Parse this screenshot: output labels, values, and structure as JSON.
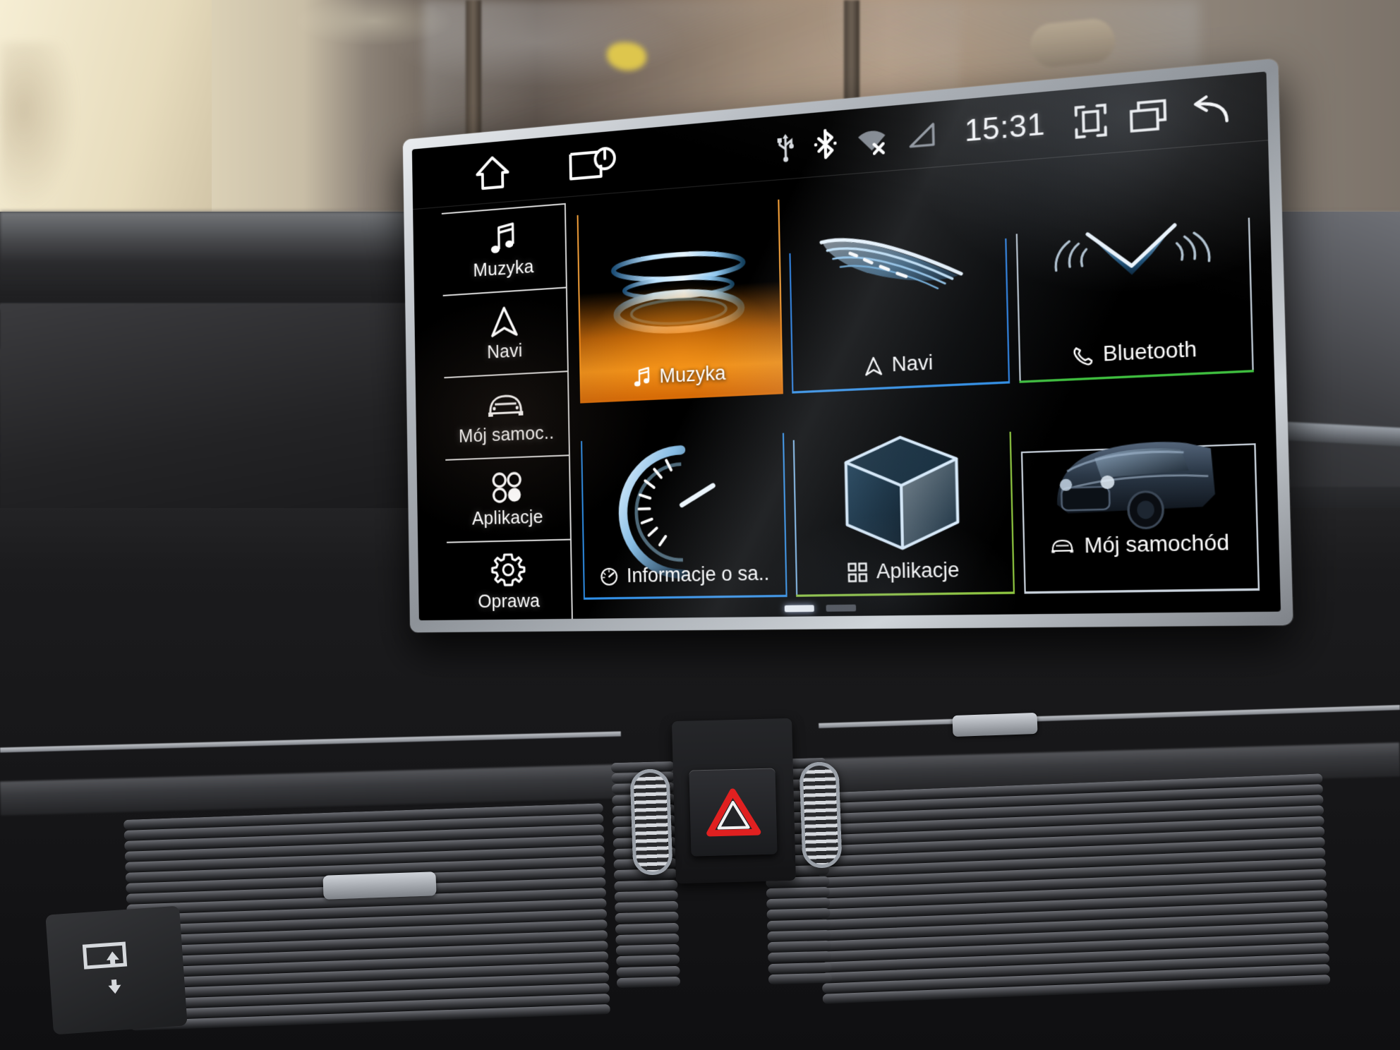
{
  "device": {
    "label": "audi-mmi-android-head-unit",
    "screen_state": "home"
  },
  "statusbar": {
    "home_label": "home-icon",
    "screen_off_label": "screen-off-icon",
    "usb_label": "usb-icon",
    "bluetooth_label": "bluetooth-icon",
    "wifi_label": "wifi-off-icon",
    "signal_label": "signal-icon",
    "clock": "15:31",
    "screenshot_label": "screenshot-icon",
    "recents_label": "recent-apps-icon",
    "back_label": "back-icon"
  },
  "sidebar": {
    "items": [
      {
        "label": "Muzyka",
        "icon": "music-note-icon"
      },
      {
        "label": "Navi",
        "icon": "navigation-arrow-icon"
      },
      {
        "label": "Mój samoc..",
        "icon": "car-front-icon"
      },
      {
        "label": "Aplikacje",
        "icon": "apps-circles-icon"
      },
      {
        "label": "Oprawa",
        "icon": "gear-icon"
      }
    ]
  },
  "grid": {
    "tiles": [
      {
        "label": "Muzyka",
        "icon": "music-note-icon",
        "accent": "#f58a12",
        "art": "audio-rings",
        "selected": true
      },
      {
        "label": "Navi",
        "icon": "navigation-arrow-icon",
        "accent": "#2a7fe0",
        "art": "road-swoosh",
        "selected": false
      },
      {
        "label": "Bluetooth",
        "icon": "phone-handset-icon",
        "accent": "#3fbf3f",
        "art": "bluetooth-waves",
        "selected": false
      },
      {
        "label": "Informacje o sa..",
        "icon": "speedometer-icon",
        "accent": "#2f8fe8",
        "art": "gauge",
        "selected": false
      },
      {
        "label": "Aplikacje",
        "icon": "apps-grid-icon",
        "accent": "#8ec63f",
        "art": "cube",
        "selected": false
      },
      {
        "label": "Mój samochód",
        "icon": "car-front-icon",
        "accent": "#c9d2dc",
        "art": "suv-photo",
        "selected": false
      }
    ]
  },
  "pager": {
    "pages": 2,
    "active": 1
  },
  "dashboard": {
    "hazard_button": "hazard-warning-button",
    "vent_knob_left": "vent-control-knob",
    "vent_knob_right": "vent-control-knob",
    "display_lift_button": "display-raise-lower-button"
  },
  "colors": {
    "accent_orange": "#f58a12",
    "accent_blue": "#2a7fe0",
    "accent_green": "#3fbf3f",
    "accent_lime": "#8ec63f",
    "screen_bg": "#000000",
    "bezel": "#b9bec4"
  }
}
